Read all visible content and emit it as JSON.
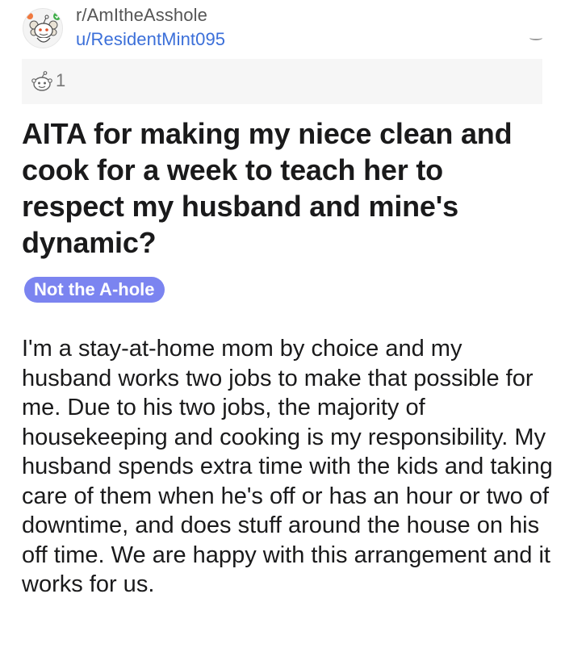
{
  "post": {
    "subreddit": "r/AmItheAsshole",
    "author": "u/ResidentMint095",
    "award_count": "1",
    "title": "AITA for making my niece clean and cook for a week to teach her to respect my husband and mine's dynamic?",
    "flair": "Not the A-hole",
    "body": "I'm a stay-at-home mom by choice and my husband works two jobs to make that possible for me. Due to his two jobs, the majority of housekeeping and cooking is my responsibility. My husband spends extra time with the kids and taking care of them when he's off or has an hour or two of downtime, and does stuff around the house on his off time. We are happy with this arrangement and it works for us."
  },
  "icons": {
    "subreddit_avatar": "snoo-judge-icon",
    "award": "award-snoo-icon"
  },
  "colors": {
    "user_link": "#3b6fd9",
    "flair_bg": "#7b84f0",
    "award_bar_bg": "#f6f6f6"
  }
}
